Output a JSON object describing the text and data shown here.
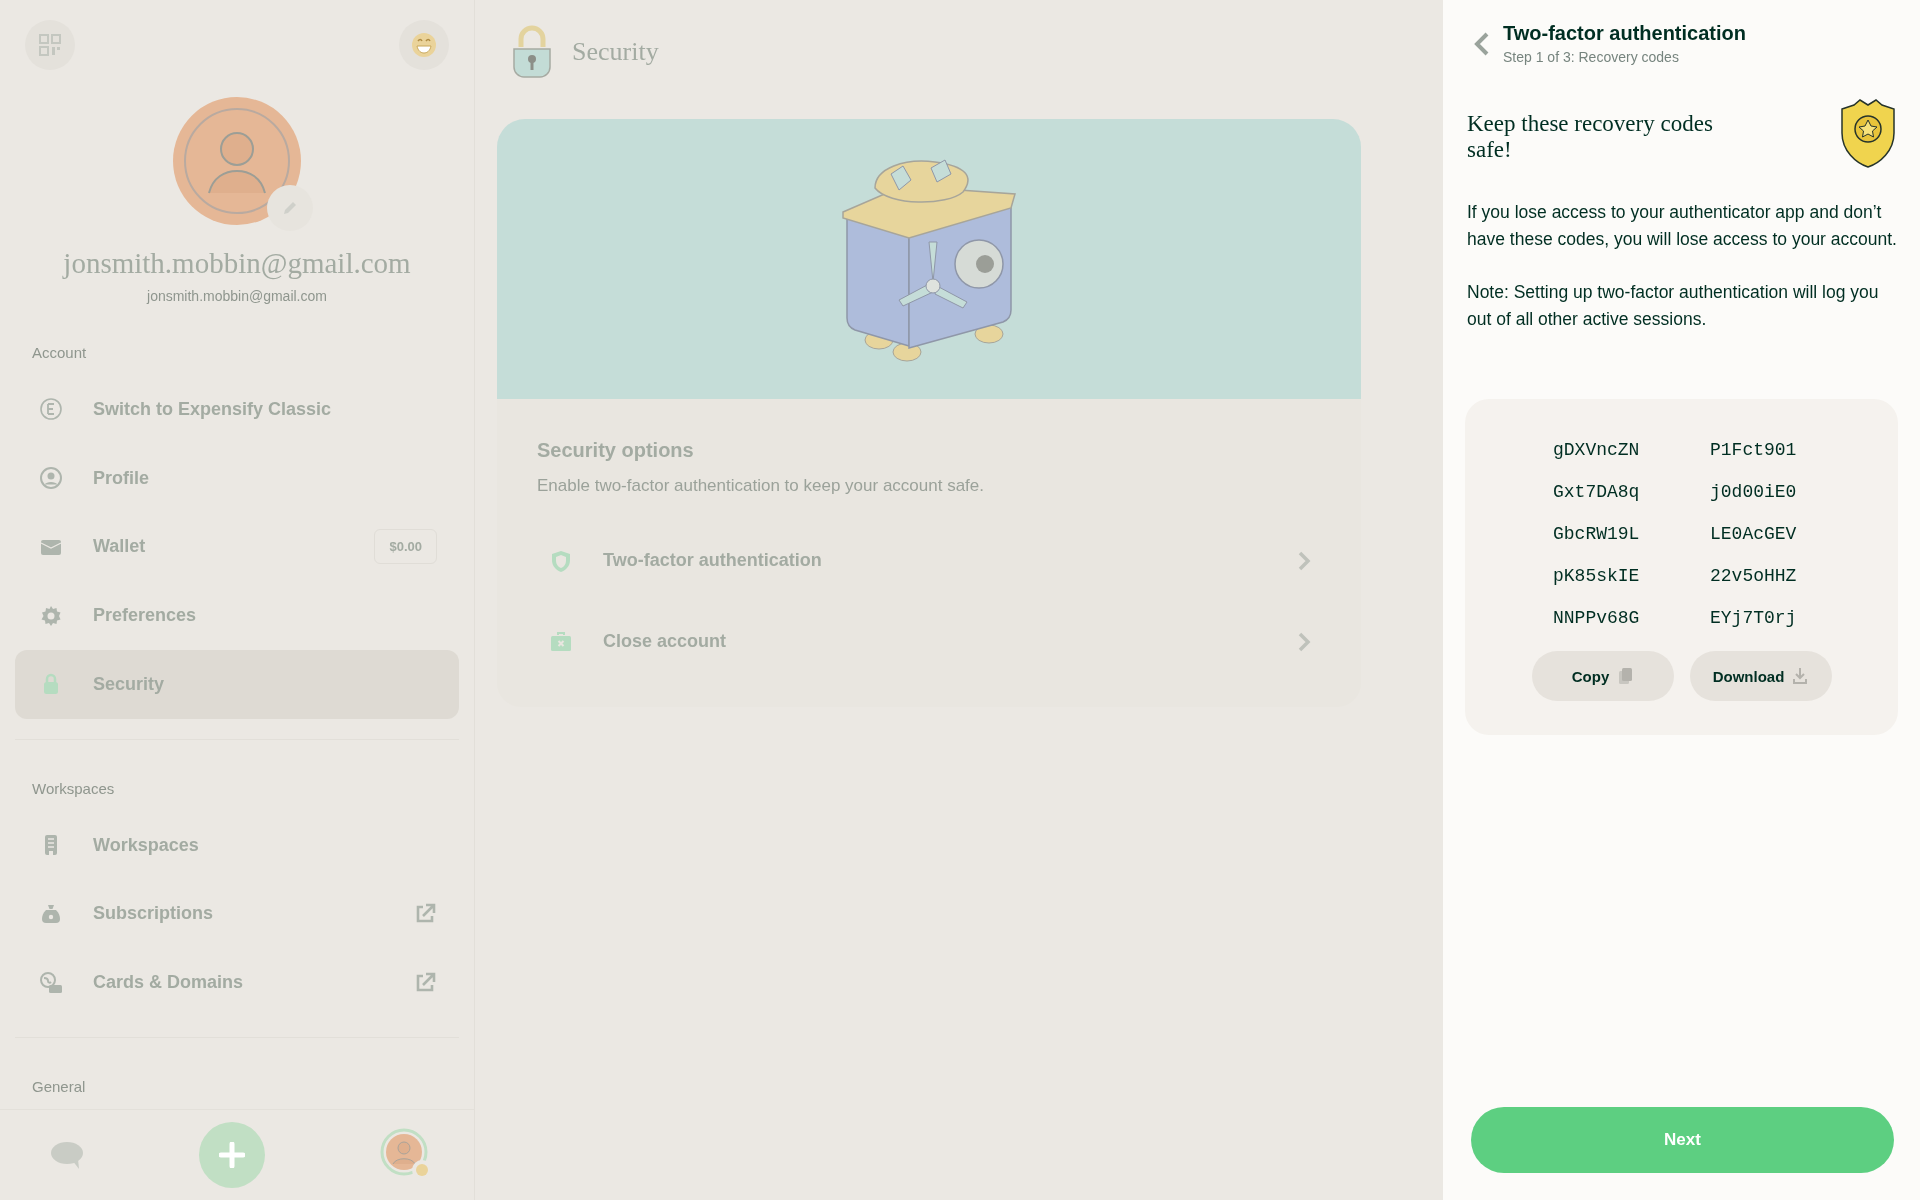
{
  "sidebar": {
    "profile": {
      "display_name": "jonsmith.mobbin@gmail.com",
      "email": "jonsmith.mobbin@gmail.com"
    },
    "sections": [
      {
        "title": "Account",
        "items": [
          {
            "label": "Switch to Expensify Classic",
            "selected": false,
            "external": false
          },
          {
            "label": "Profile",
            "selected": false,
            "external": false
          },
          {
            "label": "Wallet",
            "selected": false,
            "external": false,
            "badge": "$0.00"
          },
          {
            "label": "Preferences",
            "selected": false,
            "external": false
          },
          {
            "label": "Security",
            "selected": true,
            "external": false
          }
        ]
      },
      {
        "title": "Workspaces",
        "items": [
          {
            "label": "Workspaces",
            "selected": false,
            "external": false
          },
          {
            "label": "Subscriptions",
            "selected": false,
            "external": true
          },
          {
            "label": "Cards & Domains",
            "selected": false,
            "external": true
          }
        ]
      },
      {
        "title": "General"
      }
    ]
  },
  "page": {
    "title": "Security",
    "options_title": "Security options",
    "options_subtitle": "Enable two-factor authentication to keep your account safe.",
    "options": [
      {
        "label": "Two-factor authentication"
      },
      {
        "label": "Close account"
      }
    ]
  },
  "panel": {
    "title": "Two-factor authentication",
    "subtitle": "Step 1 of 3: Recovery codes",
    "heading": "Keep these recovery codes safe!",
    "paragraphs": [
      "If you lose access to your authenticator app and don’t have these codes, you will lose access to your account.",
      "Note: Setting up two-factor authentication will log you out of all other active sessions."
    ],
    "codes": [
      [
        "gDXVncZN",
        "P1Fct901"
      ],
      [
        "Gxt7DA8q",
        "j0d00iE0"
      ],
      [
        "GbcRW19L",
        "LE0AcGEV"
      ],
      [
        "pK85skIE",
        "22v5oHHZ"
      ],
      [
        "NNPPv68G",
        "EYj7T0rj"
      ]
    ],
    "actions": [
      {
        "label": "Copy"
      },
      {
        "label": "Download"
      }
    ],
    "next": "Next"
  }
}
